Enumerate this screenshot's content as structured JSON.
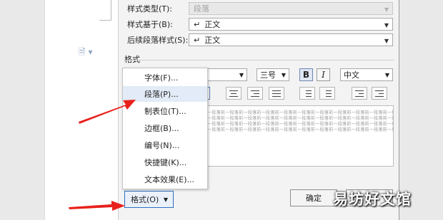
{
  "style_rows": [
    {
      "label": "样式类型(T):",
      "value": "段落",
      "disabled": true
    },
    {
      "label": "样式基于(B):",
      "value": "正文",
      "disabled": false
    },
    {
      "label": "后续段落样式(S):",
      "value": "正文",
      "disabled": false
    }
  ],
  "format_group": {
    "title": "格式",
    "font_size": "三号",
    "bold": "B",
    "italic": "I",
    "script": "中文"
  },
  "preview_text": "一段落前一段落前一段落前一段落前一段落前一段落前一段落前一段落前一段落前一段落前一段落前一段落前",
  "format_menu": {
    "items": [
      "字体(F)...",
      "段落(P)...",
      "制表位(T)...",
      "边框(B)...",
      "编号(N)...",
      "快捷键(K)...",
      "文本效果(E)..."
    ],
    "highlighted_index": 1
  },
  "buttons": {
    "format": "格式(O)",
    "ok": "确定"
  },
  "watermark": "易坊好文馆",
  "colors": {
    "arrow": "#e8201b",
    "menu_highlight": "#e2ebf7",
    "accent": "#2f6fbf"
  },
  "icons": {
    "return": "↵",
    "dropdown": "▼",
    "document": "document-icon"
  }
}
